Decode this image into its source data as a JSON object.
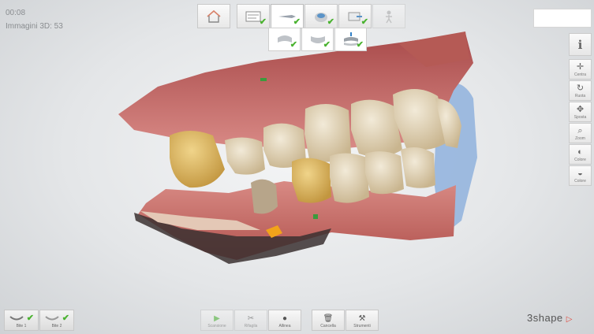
{
  "info": {
    "time": "00:08",
    "images_3d": "Immagini 3D: 53"
  },
  "workflow": {
    "home_icon": "home-icon",
    "steps": [
      {
        "icon": "order-form-icon",
        "checked": true
      },
      {
        "icon": "scanner-icon",
        "checked": true,
        "active": true
      },
      {
        "icon": "model-icon",
        "checked": true
      },
      {
        "icon": "send-icon",
        "checked": true
      },
      {
        "icon": "figure-icon",
        "checked": false,
        "disabled": true
      }
    ],
    "sub_steps": [
      {
        "icon": "upper-jaw-icon",
        "checked": true
      },
      {
        "icon": "lower-jaw-icon",
        "checked": true
      },
      {
        "icon": "bite-icon",
        "checked": true
      }
    ]
  },
  "right_tools": {
    "info_label": "i",
    "items": [
      {
        "label": "Centra",
        "icon": "center-icon"
      },
      {
        "label": "Ruota",
        "icon": "rotate-icon"
      },
      {
        "label": "Sposta",
        "icon": "move-icon"
      },
      {
        "label": "Zoom",
        "icon": "zoom-icon"
      },
      {
        "label": "Colore",
        "icon": "color-icon"
      },
      {
        "label": "Colore",
        "icon": "color-tooth-icon"
      }
    ]
  },
  "bite": [
    {
      "label": "Bite 1",
      "checked": true
    },
    {
      "label": "Bite 2",
      "checked": true
    }
  ],
  "bottom_tools": [
    {
      "label": "Scansione",
      "glyph": "▶",
      "icon": "play-icon",
      "disabled": true
    },
    {
      "label": "Rifagila",
      "glyph": "✂",
      "icon": "trim-icon",
      "disabled": true
    },
    {
      "label": "Allinea",
      "glyph": "●",
      "icon": "align-icon",
      "disabled": false
    },
    {
      "label": "Cancella",
      "glyph": "🗑",
      "icon": "delete-icon",
      "disabled": false
    },
    {
      "label": "Strumenti",
      "glyph": "⚒",
      "icon": "tools-icon",
      "disabled": false
    }
  ],
  "logo": {
    "text": "3shape",
    "mark": "▷"
  },
  "colors": {
    "check": "#49b22f",
    "gum": "#c9706b",
    "tooth": "#e4d8bd",
    "logo_mark": "#e2473b"
  }
}
